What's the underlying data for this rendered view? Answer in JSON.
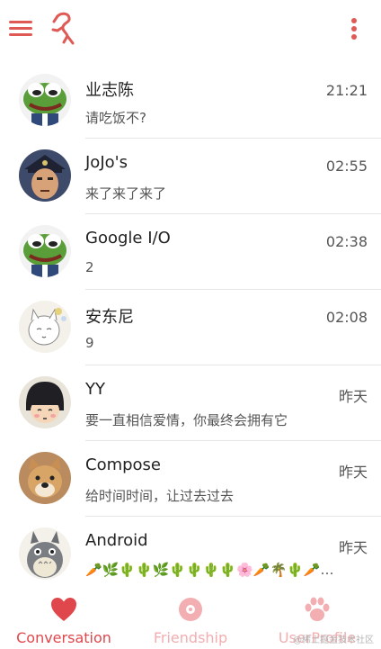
{
  "app": {
    "accent": "#e05a55",
    "icons": {
      "menu": "hamburger-icon",
      "logo": "flamingo-logo",
      "more": "more-vert-icon"
    }
  },
  "conversations": [
    {
      "name": "业志陈",
      "time": "21:21",
      "message": "请吃饭不?",
      "avatar": "frog-avatar"
    },
    {
      "name": "JoJo's",
      "time": "02:55",
      "message": "来了来了来了",
      "avatar": "jojo-avatar"
    },
    {
      "name": "Google I/O",
      "time": "02:38",
      "message": "2",
      "avatar": "frog-avatar"
    },
    {
      "name": "安东尼",
      "time": "02:08",
      "message": "9",
      "avatar": "sketch-avatar"
    },
    {
      "name": "YY",
      "time": "昨天",
      "message": "要一直相信爱情，你最终会拥有它",
      "avatar": "girl-avatar"
    },
    {
      "name": "Compose",
      "time": "昨天",
      "message": "给时间时间，让过去过去",
      "avatar": "dog-avatar"
    },
    {
      "name": "Android",
      "time": "昨天",
      "message": "🥕🌿🌵🌵🌿🌵🌵🌵🌵🌸🥕🌴🌵🥕…",
      "avatar": "totoro-avatar"
    }
  ],
  "bottom_nav": {
    "tabs": [
      {
        "label": "Conversation",
        "icon": "heart-icon",
        "active": true
      },
      {
        "label": "Friendship",
        "icon": "disc-icon",
        "active": false
      },
      {
        "label": "UserProfile",
        "icon": "paw-icon",
        "active": false
      }
    ]
  },
  "watermark": "@稀土掘金技术社区"
}
